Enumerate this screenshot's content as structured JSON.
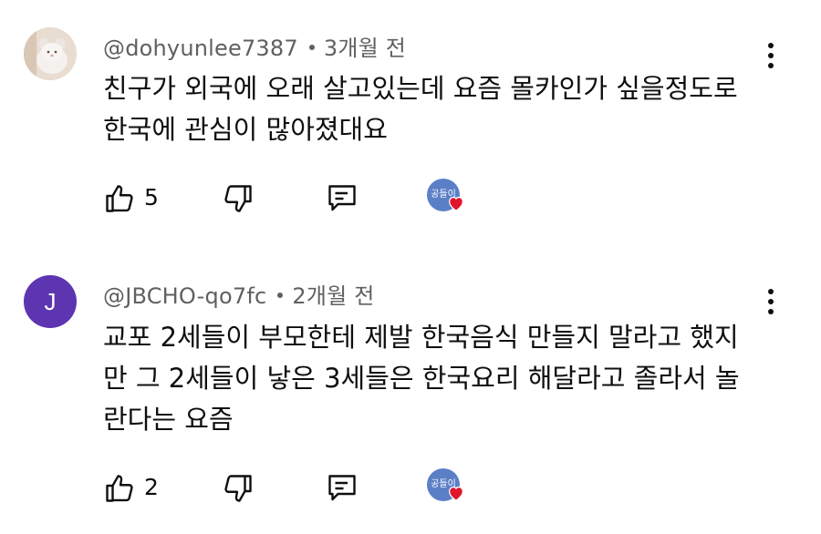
{
  "comments": [
    {
      "handle": "@dohyunlee7387",
      "time": "3개월 전",
      "text": "친구가 외국에 오래 살고있는데 요즘 몰카인가 싶을정도로\n한국에 관심이 많아졌대요",
      "likes": "5",
      "avatar_type": "photo",
      "creator_badge_text": "공들이"
    },
    {
      "handle": "@JBCHO-qo7fc",
      "time": "2개월 전",
      "text": "교포 2세들이 부모한테 제발 한국음식 만들지 말라고 했지\n만 그 2세들이 낳은 3세들은 한국요리 해달라고 졸라서 놀\n란다는 요즘",
      "likes": "2",
      "avatar_type": "letter",
      "avatar_letter": "J",
      "creator_badge_text": "공들이"
    }
  ],
  "icons": {
    "like": "thumbs-up-icon",
    "dislike": "thumbs-down-icon",
    "reply": "reply-icon",
    "more": "more-vert-icon",
    "heart": "heart-icon"
  },
  "colors": {
    "text": "#0f0f0f",
    "meta": "#606060",
    "letter_avatar": "#5e35b1",
    "heart": "#e0162b",
    "creator_avatar": "#5b7fc7"
  }
}
